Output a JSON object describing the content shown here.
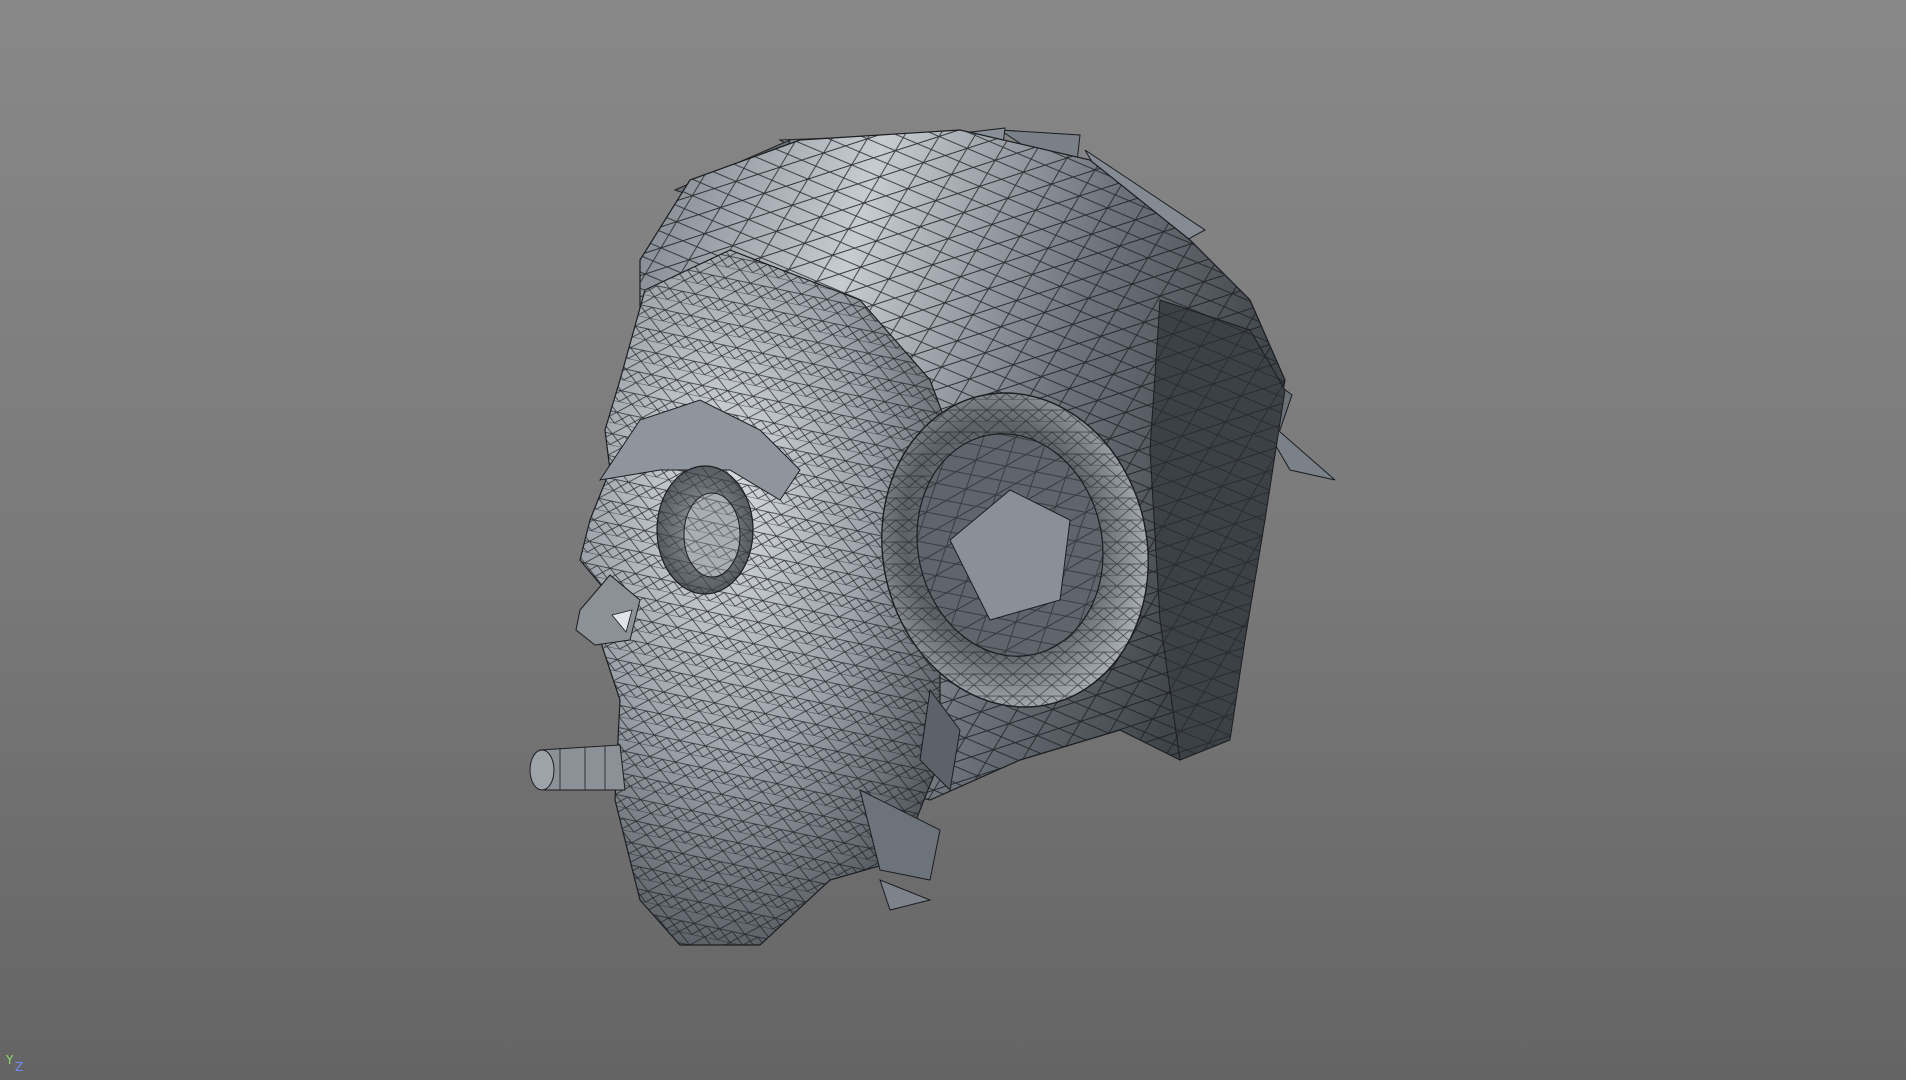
{
  "viewport": {
    "background_top": "#888888",
    "background_bottom": "#646464",
    "mesh_fill_light": "#c3c8ce",
    "mesh_fill_dark": "#3f4348",
    "wire_color": "#1b1d20",
    "model_icon": "low-poly-monkey-head-mesh"
  },
  "axis_gizmo": {
    "y_label": "Y",
    "z_label": "Z",
    "y_color": "#8fdc6e",
    "z_color": "#6f8cff"
  }
}
